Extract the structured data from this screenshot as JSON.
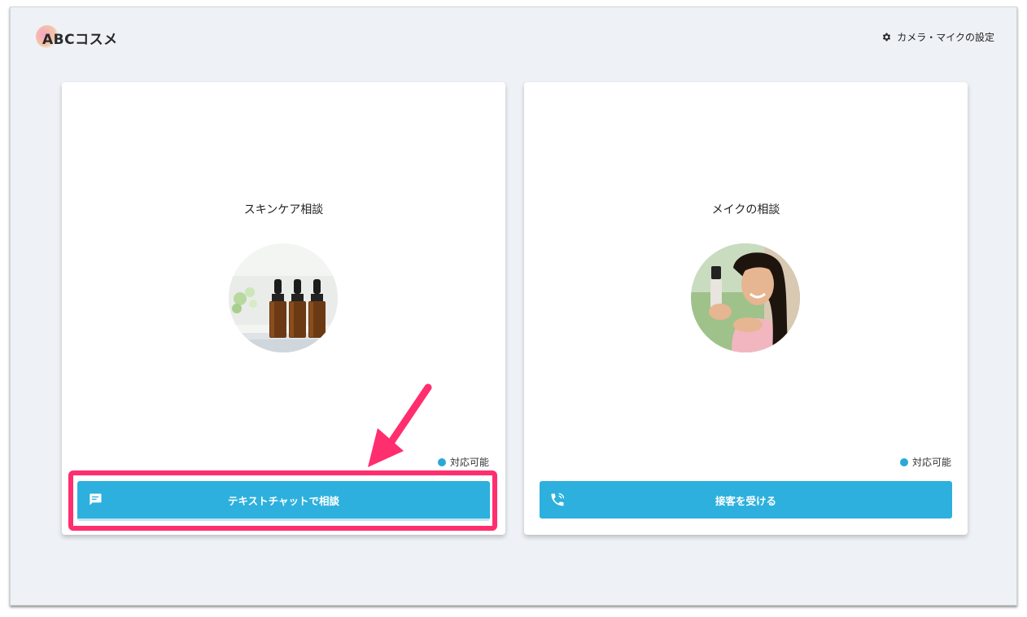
{
  "header": {
    "logo_text": "ABCコスメ",
    "settings_label": "カメラ・マイクの設定",
    "settings_icon": "gear-icon"
  },
  "cards": [
    {
      "title": "スキンケア相談",
      "status": "対応可能",
      "button_label": "テキストチャットで相談",
      "button_icon": "chat-icon",
      "image": "dropper-bottles-image"
    },
    {
      "title": "メイクの相談",
      "status": "対応可能",
      "button_label": "接客を受ける",
      "button_icon": "phone-icon",
      "image": "woman-with-cosmetic-image"
    }
  ],
  "colors": {
    "accent": "#2db0dd",
    "status_dot": "#2aa8d8",
    "highlight": "#ff2e6e",
    "background": "#eef2f6"
  }
}
